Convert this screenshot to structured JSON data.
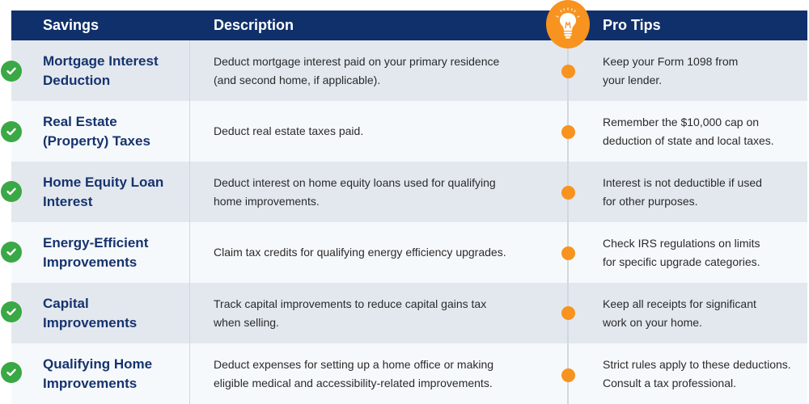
{
  "header": {
    "savings": "Savings",
    "description": "Description",
    "pro_tips": "Pro Tips",
    "icon": "lightbulb-icon"
  },
  "colors": {
    "header_bg": "#10306b",
    "accent_orange": "#f7931e",
    "check_green": "#3aa845",
    "title_blue": "#16336e"
  },
  "rows": [
    {
      "savings": "Mortgage Interest Deduction",
      "savings_lines": [
        "Mortgage Interest",
        "Deduction"
      ],
      "description_lines": [
        "Deduct mortgage interest paid on your primary residence",
        "(and second home, if applicable)."
      ],
      "tip_lines": [
        "Keep your Form 1098 from",
        "your lender."
      ]
    },
    {
      "savings": "Real Estate (Property) Taxes",
      "savings_lines": [
        "Real Estate",
        "(Property) Taxes"
      ],
      "description_lines": [
        "Deduct real estate taxes paid."
      ],
      "tip_lines": [
        "Remember the $10,000 cap on",
        "deduction of state and local taxes."
      ]
    },
    {
      "savings": "Home Equity Loan Interest",
      "savings_lines": [
        "Home Equity Loan",
        "Interest"
      ],
      "description_lines": [
        "Deduct interest on home equity loans used for qualifying",
        "home improvements."
      ],
      "tip_lines": [
        "Interest is not deductible if used",
        "for other purposes."
      ]
    },
    {
      "savings": "Energy-Efficient Improvements",
      "savings_lines": [
        "Energy-Efficient",
        "Improvements"
      ],
      "description_lines": [
        "Claim tax credits for qualifying energy efficiency upgrades."
      ],
      "tip_lines": [
        "Check IRS regulations on limits",
        "for specific upgrade categories."
      ]
    },
    {
      "savings": "Capital Improvements",
      "savings_lines": [
        "Capital",
        "Improvements"
      ],
      "description_lines": [
        "Track capital improvements to reduce capital gains tax",
        "when selling."
      ],
      "tip_lines": [
        "Keep all receipts for significant",
        "work on your home."
      ]
    },
    {
      "savings": "Qualifying Home Improvements",
      "savings_lines": [
        "Qualifying Home",
        "Improvements"
      ],
      "description_lines": [
        "Deduct expenses for setting up a home office or making",
        "eligible medical and accessibility-related improvements."
      ],
      "tip_lines": [
        "Strict rules apply to these deductions.",
        "Consult a tax professional."
      ]
    }
  ]
}
